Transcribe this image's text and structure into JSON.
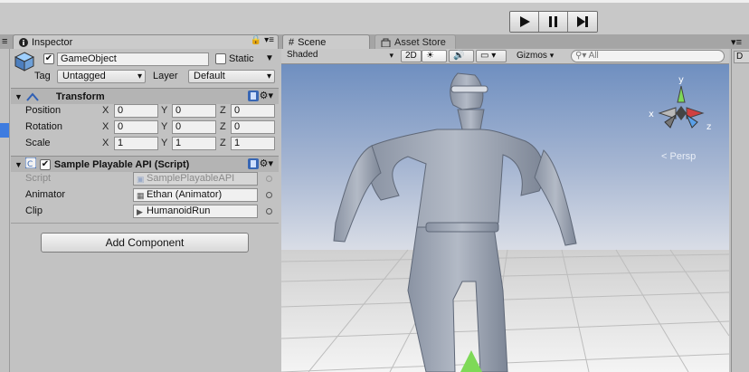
{
  "toolbar": {
    "play_icon": "play-icon",
    "pause_icon": "pause-icon",
    "step_icon": "step-icon"
  },
  "tabs": {
    "inspector": "Inspector",
    "scene": "Scene",
    "asset_store": "Asset Store"
  },
  "inspector": {
    "object_name": "GameObject",
    "active_checked": true,
    "static_label": "Static",
    "tag_label": "Tag",
    "tag_value": "Untagged",
    "layer_label": "Layer",
    "layer_value": "Default",
    "transform": {
      "title": "Transform",
      "position_label": "Position",
      "rotation_label": "Rotation",
      "scale_label": "Scale",
      "x": "X",
      "y": "Y",
      "z": "Z",
      "position": [
        "0",
        "0",
        "0"
      ],
      "rotation": [
        "0",
        "0",
        "0"
      ],
      "scale": [
        "1",
        "1",
        "1"
      ]
    },
    "script_component": {
      "title": "Sample Playable API (Script)",
      "script_label": "Script",
      "script_value": "SamplePlayableAPI",
      "animator_label": "Animator",
      "animator_value": "Ethan (Animator)",
      "clip_label": "Clip",
      "clip_value": "HumanoidRun"
    },
    "add_component": "Add Component"
  },
  "scene": {
    "shading": "Shaded",
    "mode_2d": "2D",
    "gizmos": "Gizmos",
    "search_placeholder": "All",
    "persp_label": "Persp",
    "gizmo_y": "y",
    "gizmo_x": "x",
    "gizmo_z": "z"
  },
  "right_panel": {
    "tab_letter": "D"
  },
  "colors": {
    "selection": "#3e7ce0",
    "sky_top": "#6f8fc0",
    "sky_horizon": "#d9dde6",
    "ground": "#e6e6e6"
  }
}
